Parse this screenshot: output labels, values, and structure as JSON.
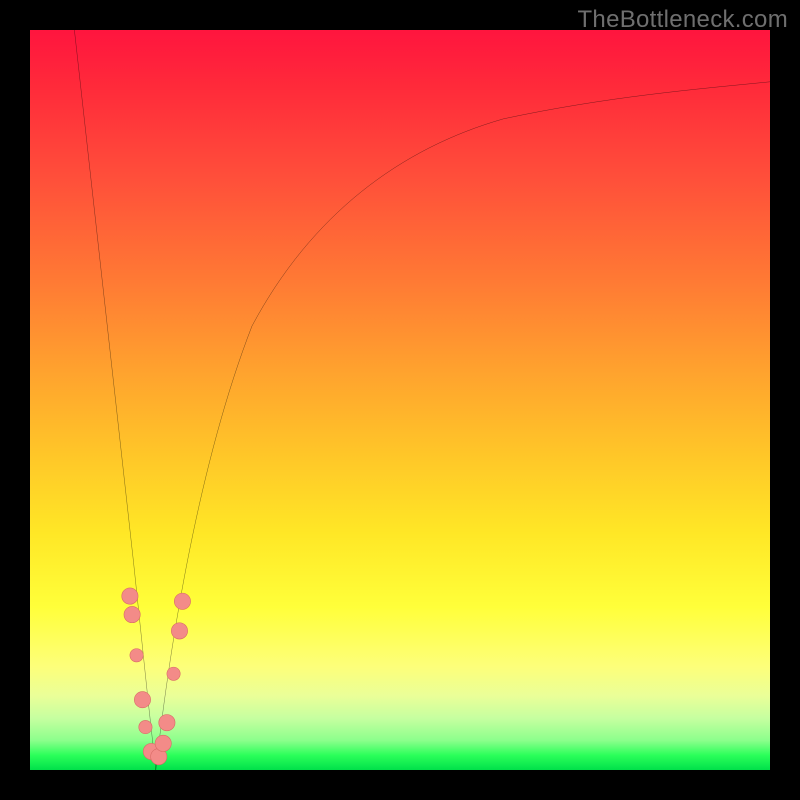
{
  "watermark": "TheBottleneck.com",
  "colors": {
    "background": "#000000",
    "curve": "#000000",
    "marker_fill": "#f38b88",
    "marker_stroke": "#d96b66",
    "gradient_stops": [
      "#ff153e",
      "#ff4f3a",
      "#ffa22e",
      "#ffe726",
      "#ffff3a",
      "#c6ffa0",
      "#00e04a"
    ]
  },
  "chart_data": {
    "type": "line",
    "title": "",
    "xlabel": "",
    "ylabel": "",
    "xlim": [
      0,
      100
    ],
    "ylim": [
      0,
      100
    ],
    "grid": false,
    "legend": false,
    "series": [
      {
        "name": "left-branch",
        "comment": "Descending branch of V shape; y≈100 at x≈6, y≈0 at x≈17",
        "x": [
          6,
          8,
          10,
          12,
          14,
          16,
          17
        ],
        "values": [
          100,
          82,
          64,
          46,
          28,
          9,
          0
        ]
      },
      {
        "name": "right-branch",
        "comment": "Rising saturating branch; y=0 at x≈17, asymptote ≈93 at x=100",
        "x": [
          17,
          19,
          21,
          24,
          28,
          33,
          40,
          50,
          62,
          78,
          100
        ],
        "values": [
          0,
          14,
          27,
          40,
          52,
          62,
          71,
          79,
          85,
          90,
          93
        ]
      }
    ],
    "markers": {
      "comment": "Salmon bead markers clustered near V bottom; (x,y) in axis units",
      "points": [
        [
          13.5,
          23.5
        ],
        [
          13.8,
          21.0
        ],
        [
          14.4,
          15.5
        ],
        [
          15.2,
          9.5
        ],
        [
          15.6,
          5.8
        ],
        [
          16.4,
          2.5
        ],
        [
          17.4,
          1.8
        ],
        [
          18.0,
          3.6
        ],
        [
          18.5,
          6.4
        ],
        [
          19.4,
          13.0
        ],
        [
          20.2,
          18.8
        ],
        [
          20.6,
          22.8
        ]
      ]
    }
  }
}
